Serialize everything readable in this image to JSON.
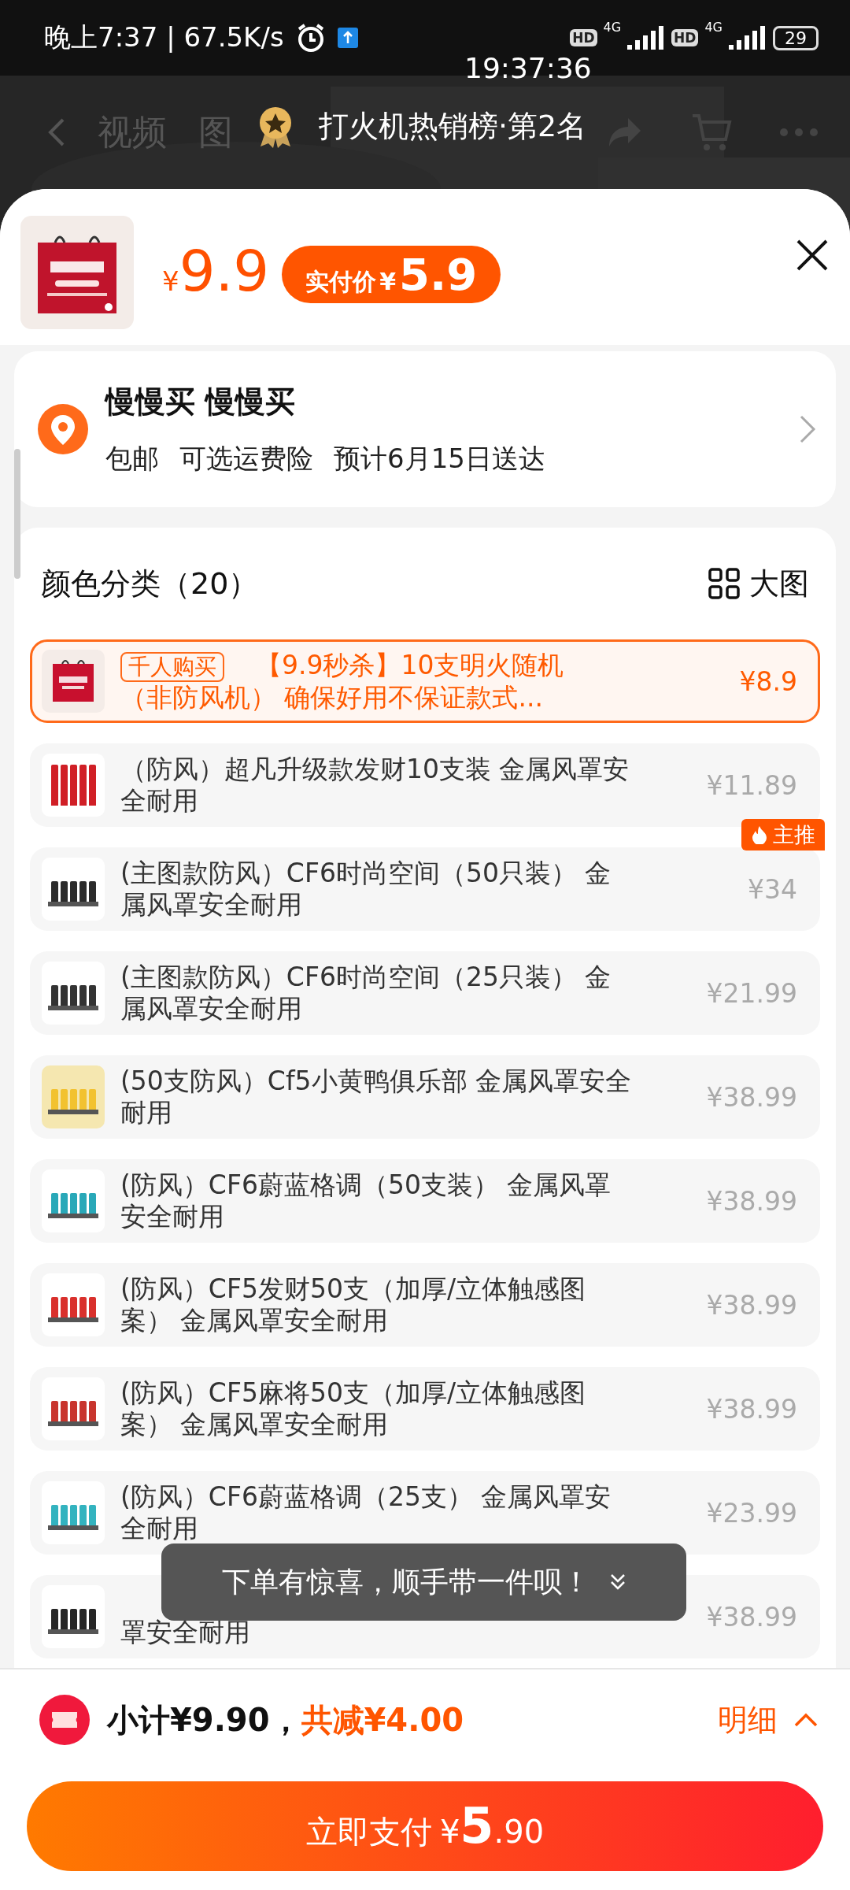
{
  "status_bar": {
    "time_label": "晚上7:37 | 67.5K/s",
    "clock": "19:37:36",
    "hd_1": "HD",
    "network_1": "4G",
    "hd_2": "HD",
    "network_2": "4G",
    "battery": "29"
  },
  "background_page": {
    "tabs": [
      "视频",
      "图"
    ],
    "rank_badge": "打火机热销榜·第2名"
  },
  "sheet": {
    "price_symbol": "¥",
    "price": "9.9",
    "pay_label": "实付价",
    "pay_symbol": "¥",
    "pay_price": "5.9"
  },
  "address": {
    "name": "慢慢买 慢慢买",
    "details": [
      "包邮",
      "可选运费险",
      "预计6月15日送达"
    ]
  },
  "options": {
    "title": "颜色分类（20）",
    "view_toggle": "大图",
    "items": [
      {
        "kind": "full",
        "selected": true,
        "tag": "千人购买",
        "name": "【9.9秒杀】10支明火随机（非防风机） 确保好用不保证款式...",
        "price": "¥8.9"
      },
      {
        "kind": "full",
        "selected": false,
        "name": "（防风）超凡升级款发财10支装 金属风罩安全耐用",
        "price": "¥11.89"
      },
      {
        "kind": "full",
        "selected": false,
        "badge": "主推",
        "name": "(主图款防风）CF6时尚空间（50只装） 金属风罩安全耐用",
        "price": "¥34"
      },
      {
        "kind": "full",
        "selected": false,
        "name": "(主图款防风）CF6时尚空间（25只装） 金属风罩安全耐用",
        "price": "¥21.99"
      },
      {
        "kind": "full",
        "selected": false,
        "name": "(50支防风）Cf5小黄鸭俱乐部 金属风罩安全耐用",
        "price": "¥38.99"
      },
      {
        "kind": "full",
        "selected": false,
        "name": "(防风）CF6蔚蓝格调（50支装） 金属风罩安全耐用",
        "price": "¥38.99"
      },
      {
        "kind": "full",
        "selected": false,
        "name": "(防风）CF5发财50支（加厚/立体触感图案） 金属风罩安全耐用",
        "price": "¥38.99"
      },
      {
        "kind": "full",
        "selected": false,
        "name": "(防风）CF5麻将50支（加厚/立体触感图案） 金属风罩安全耐用",
        "price": "¥38.99"
      },
      {
        "kind": "full",
        "selected": false,
        "name": "(防风）CF6蔚蓝格调（25支） 金属风罩安全耐用",
        "price": "¥23.99"
      },
      {
        "kind": "covered",
        "selected": false,
        "name": "罩安全耐用",
        "price": "¥38.99"
      }
    ]
  },
  "toast": {
    "text": "下单有惊喜，顺手带一件呗！"
  },
  "footer": {
    "subtotal": "小计¥9.90，",
    "discount": "共减¥4.00",
    "details_link": "明细",
    "pay_button": {
      "label": "立即支付",
      "symbol": "¥",
      "integer": "5",
      "decimal": ".90"
    }
  }
}
